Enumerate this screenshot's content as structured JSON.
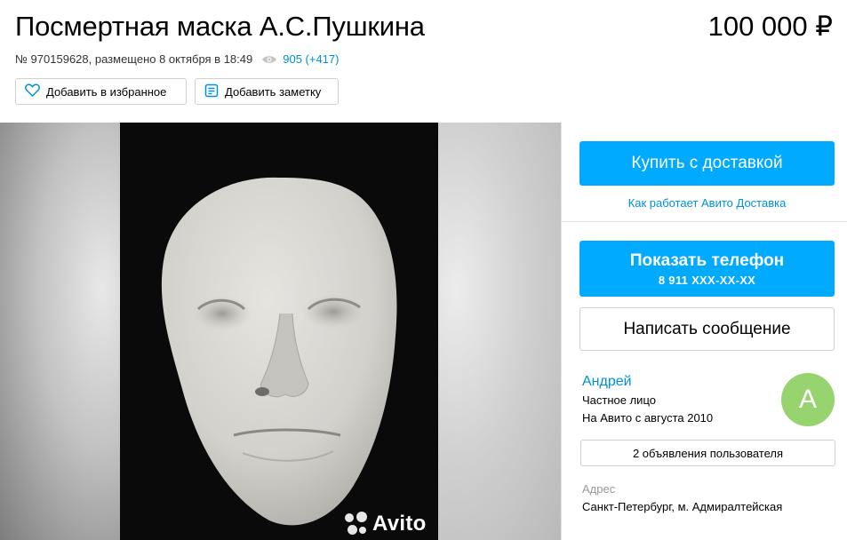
{
  "listing": {
    "title": "Посмертная маска А.С.Пушкина",
    "price": "100 000 ₽",
    "meta": "№ 970159628, размещено 8 октября в 18:49",
    "views": "905 (+417)"
  },
  "actions": {
    "favorite_label": "Добавить в избранное",
    "note_label": "Добавить заметку"
  },
  "gallery": {
    "watermark": "Avito"
  },
  "sidebar": {
    "buy_label": "Купить с доставкой",
    "delivery_link": "Как работает Авито Доставка",
    "phone_label": "Показать телефон",
    "phone_number": "8 911 XXX-XX-XX",
    "message_label": "Написать сообщение"
  },
  "seller": {
    "name": "Андрей",
    "type": "Частное лицо",
    "since": "На Авито с августа 2010",
    "avatar_letter": "А",
    "ads_label": "2 объявления пользователя",
    "address_label": "Адрес",
    "address": "Санкт-Петербург, м. Адмиралтейская"
  },
  "colors": {
    "accent": "#00aaff",
    "link": "#0091d9",
    "avatar": "#97d46f"
  },
  "icons": [
    "eye-icon",
    "heart-icon",
    "note-icon",
    "avito-logo-icon"
  ]
}
